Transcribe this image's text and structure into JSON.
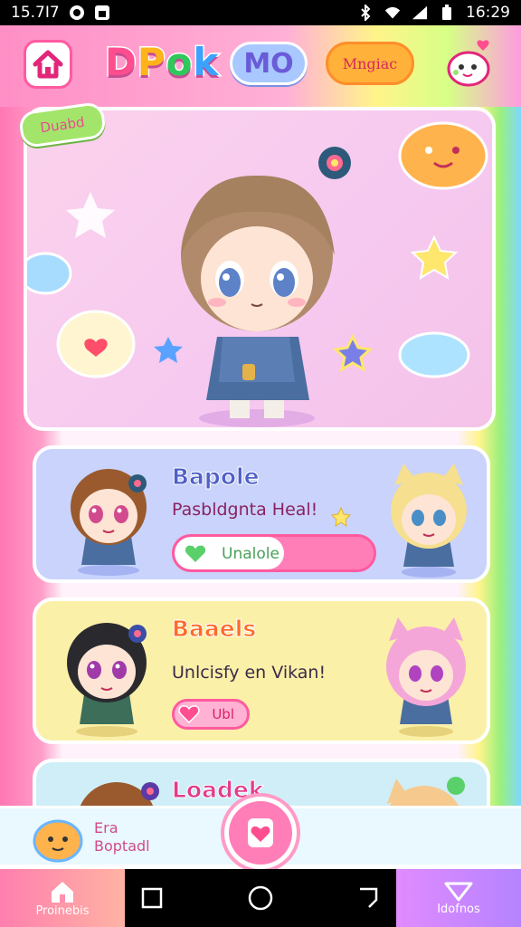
{
  "status_bar": {
    "left_time": "15.7I7",
    "right_time": "16:29"
  },
  "header": {
    "logo": [
      "D",
      "P",
      "o",
      "k",
      ""
    ],
    "logo_text": "DPok",
    "mo_pill_label": "MO",
    "orange_pill_label": "Mngiac"
  },
  "hero": {
    "tag_label": "Duabd"
  },
  "cards": [
    {
      "title": "Bapole",
      "text": "Pasbldgnta Heal!",
      "progress_label": "Unalole",
      "progress_fraction": 0.55
    },
    {
      "title": "Baaels",
      "text": "Unlcisfy en Vikan!",
      "button_label": "Ubl"
    },
    {
      "title": "Loadek"
    }
  ],
  "banner": {
    "line1": "Era",
    "line2": "Boptadl"
  },
  "nav": {
    "left_label": "Proinebis",
    "right_label": "Idofnos"
  },
  "colors": {
    "accent_pink": "#ff5aa0",
    "accent_blue": "#5060c8",
    "accent_orange": "#ff6a2a"
  }
}
